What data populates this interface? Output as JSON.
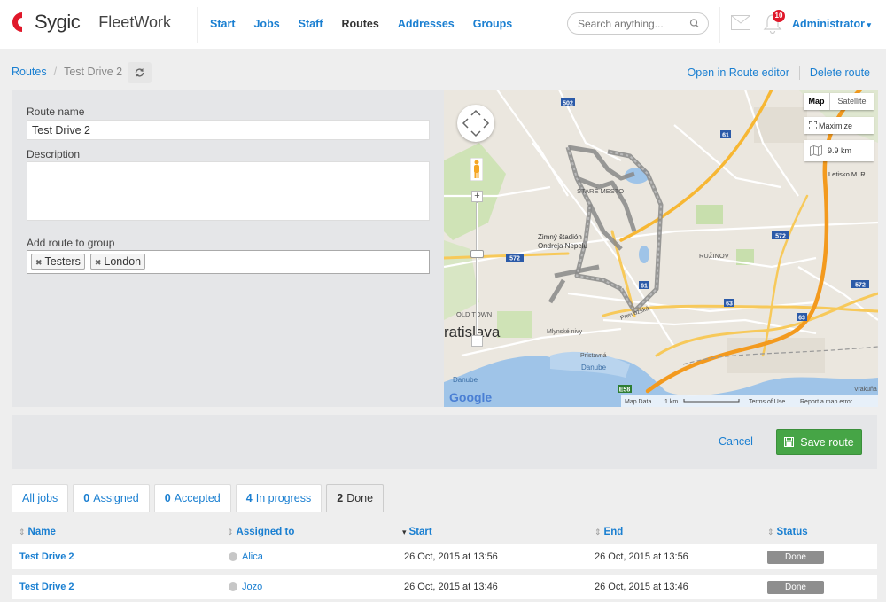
{
  "header": {
    "logo_text": "Sygic",
    "app_name": "FleetWork",
    "nav": [
      "Start",
      "Jobs",
      "Staff",
      "Routes",
      "Addresses",
      "Groups"
    ],
    "active_nav": "Routes",
    "search_placeholder": "Search anything...",
    "notification_count": "10",
    "user": "Administrator"
  },
  "breadcrumb": {
    "root": "Routes",
    "separator": "/",
    "current": "Test Drive 2"
  },
  "top_actions": {
    "open_editor": "Open in Route editor",
    "delete": "Delete route"
  },
  "form": {
    "route_name_label": "Route name",
    "route_name_value": "Test Drive 2",
    "description_label": "Description",
    "description_value": "",
    "group_label": "Add route to group",
    "groups": [
      "Testers",
      "London"
    ]
  },
  "map": {
    "type_map": "Map",
    "type_satellite": "Satellite",
    "maximize": "Maximize",
    "distance": "9.9 km",
    "city_label": "ratislava",
    "old_town": "OLD TOWN",
    "stare_mesto": "STARÉ MESTO",
    "ruzinov": "RUŽINOV",
    "zimny": "Zimný štadión",
    "ondrej": "Ondreja Nepelu",
    "danube1": "Danube",
    "danube2": "Danube",
    "letisko": "Letisko M. R.",
    "prievozska": "Prievozská",
    "mlynske": "Mlynské nivy",
    "pristavna": "Prístavná",
    "road_502": "502",
    "road_61a": "61",
    "road_61b": "61",
    "road_572a": "572",
    "road_572b": "572",
    "road_572c": "572",
    "road_63a": "63",
    "road_63b": "63",
    "road_e58": "E58",
    "google": "Google",
    "attr_data": "Map Data",
    "attr_scale": "1 km",
    "attr_terms": "Terms of Use",
    "attr_report": "Report a map error",
    "vrakuna": "Vrakuňa",
    "zoom_in": "+",
    "zoom_out": "−"
  },
  "actions": {
    "cancel": "Cancel",
    "save": "Save route"
  },
  "tabs": [
    {
      "count": "",
      "label": "All jobs"
    },
    {
      "count": "0",
      "label": "Assigned"
    },
    {
      "count": "0",
      "label": "Accepted"
    },
    {
      "count": "4",
      "label": "In progress"
    },
    {
      "count": "2",
      "label": "Done"
    }
  ],
  "table": {
    "columns": [
      "Name",
      "Assigned to",
      "Start",
      "End",
      "Status"
    ],
    "rows": [
      {
        "name": "Test Drive 2",
        "assigned": "Alica",
        "start": "26 Oct, 2015 at 13:56",
        "end": "26 Oct, 2015 at 13:56",
        "status": "Done"
      },
      {
        "name": "Test Drive 2",
        "assigned": "Jozo",
        "start": "26 Oct, 2015 at 13:46",
        "end": "26 Oct, 2015 at 13:46",
        "status": "Done"
      }
    ]
  },
  "colors": {
    "link": "#1a7fd1",
    "logo_red": "#e0182a",
    "save_green": "#46a546",
    "status_grey": "#8e8e8e"
  }
}
